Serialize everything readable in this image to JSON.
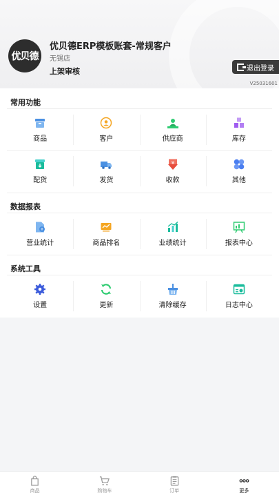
{
  "header": {
    "avatar_text": "优贝德",
    "account_title": "优贝德ERP模板账套-常规客户",
    "store": "无锡店",
    "status": "上架审核",
    "logout_label": "退出登录",
    "version": "V25031601"
  },
  "sections": [
    {
      "title": "常用功能",
      "rows": [
        [
          {
            "label": "商品",
            "icon": "product-icon",
            "color": "#4a90e2"
          },
          {
            "label": "客户",
            "icon": "customer-icon",
            "color": "#f5a623"
          },
          {
            "label": "供应商",
            "icon": "supplier-icon",
            "color": "#2ecc71"
          },
          {
            "label": "库存",
            "icon": "inventory-icon",
            "color": "#a05cf0"
          }
        ],
        [
          {
            "label": "配货",
            "icon": "distribution-icon",
            "color": "#1abc9c"
          },
          {
            "label": "发货",
            "icon": "shipping-icon",
            "color": "#4a90e2"
          },
          {
            "label": "收款",
            "icon": "payment-icon",
            "color": "#e74c3c"
          },
          {
            "label": "其他",
            "icon": "other-icon",
            "color": "#4a7ef0"
          }
        ]
      ]
    },
    {
      "title": "数据报表",
      "rows": [
        [
          {
            "label": "营业统计",
            "icon": "business-stats-icon",
            "color": "#4a90e2"
          },
          {
            "label": "商品排名",
            "icon": "product-ranking-icon",
            "color": "#f5a623"
          },
          {
            "label": "业绩统计",
            "icon": "performance-stats-icon",
            "color": "#1abc9c"
          },
          {
            "label": "报表中心",
            "icon": "report-center-icon",
            "color": "#2ecc71"
          }
        ]
      ]
    },
    {
      "title": "系统工具",
      "rows": [
        [
          {
            "label": "设置",
            "icon": "settings-icon",
            "color": "#3b5bdb"
          },
          {
            "label": "更新",
            "icon": "update-icon",
            "color": "#2ecc71"
          },
          {
            "label": "清除缓存",
            "icon": "clear-cache-icon",
            "color": "#4a90e2"
          },
          {
            "label": "日志中心",
            "icon": "log-center-icon",
            "color": "#1abc9c"
          }
        ]
      ]
    }
  ],
  "tabbar": [
    {
      "label": "商品",
      "icon": "bag-icon",
      "active": false
    },
    {
      "label": "购物车",
      "icon": "cart-icon",
      "active": false
    },
    {
      "label": "订单",
      "icon": "order-icon",
      "active": false
    },
    {
      "label": "更多",
      "icon": "more-icon",
      "active": true
    }
  ]
}
